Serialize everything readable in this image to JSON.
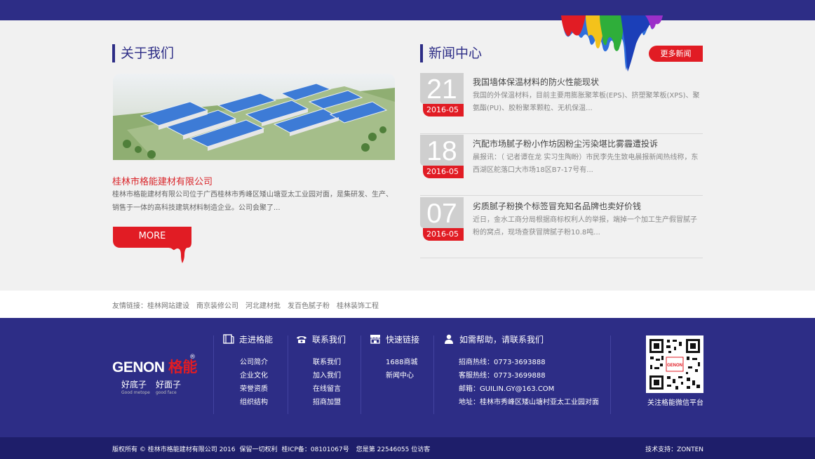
{
  "about": {
    "title": "关于我们",
    "company_name": "桂林市格能建材有限公司",
    "description": "桂林市格能建材有限公司位于广西桂林市秀峰区矮山塘亚太工业园对面，是集研发、生产、销售于一体的高科技建筑材料制造企业。公司会聚了...",
    "more_label": "MORE"
  },
  "news": {
    "title": "新闻中心",
    "more_label": "更多新闻",
    "items": [
      {
        "day": "21",
        "ym": "2016-05",
        "title": "我国墙体保温材料的防火性能现状",
        "desc": "我国的外保温材料，目前主要用膨胀聚苯板(EPS)、挤塑聚苯板(XPS)、聚氨酯(PU)、胶粉聚苯颗粒、无机保温..."
      },
      {
        "day": "18",
        "ym": "2016-05",
        "title": "汽配市场腻子粉小作坊因粉尘污染堪比雾霾遭投诉",
        "desc": "晨报讯：（ 记者谭在龙 实习生陶盼）市民李先生致电晨报新闻热线称，东西湖区舵落口大市场18区B7-17号有..."
      },
      {
        "day": "07",
        "ym": "2016-05",
        "title": "劣质腻子粉换个标签冒充知名品牌也卖好价钱",
        "desc": "近日，金水工商分局根据商标权利人的举报，端掉一个加工生产假冒腻子粉的窝点，现场查获冒牌腻子粉10.8吨..."
      }
    ]
  },
  "friend_links": {
    "label": "友情链接：",
    "items": [
      "桂林网站建设",
      "南京装修公司",
      "河北建材批",
      "发百色腻子粉",
      "桂林装饰工程"
    ]
  },
  "footer": {
    "logo_en": "GENON",
    "logo_cn": "格能",
    "logo_reg": "®",
    "slogan1": "好底子",
    "slogan1_en": "Good metope",
    "slogan2": "好面子",
    "slogan2_en": "good face",
    "col1": {
      "title": "走进格能",
      "icon": "book-icon",
      "items": [
        "公司简介",
        "企业文化",
        "荣誉资质",
        "组织结构"
      ]
    },
    "col2": {
      "title": "联系我们",
      "icon": "phone-icon",
      "items": [
        "联系我们",
        "加入我们",
        "在线留言",
        "招商加盟"
      ]
    },
    "col3": {
      "title": "快速链接",
      "icon": "store-icon",
      "items": [
        "1688商城",
        "新闻中心"
      ]
    },
    "col4": {
      "title": "如需帮助，请联系我们",
      "icon": "user-icon",
      "items": [
        "招商热线：0773-3693888",
        "客服热线：0773-3699888",
        "邮箱：GUILIN.GY@163.COM",
        "地址：桂林市秀峰区矮山塘村亚太工业园对面"
      ]
    },
    "qr_label": "关注格能微信平台",
    "qr_text": "GENON"
  },
  "bottom": {
    "copyright": "版权所有 © 桂林市格能建材有限公司 2016",
    "rights": "保留一切权利",
    "icp": "桂ICP备：08101067号",
    "visitors": "您是第 22546055 位访客",
    "support": "技术支持：ZONTEN"
  },
  "colors": {
    "primary": "#2d2d86",
    "accent": "#e11c24"
  }
}
